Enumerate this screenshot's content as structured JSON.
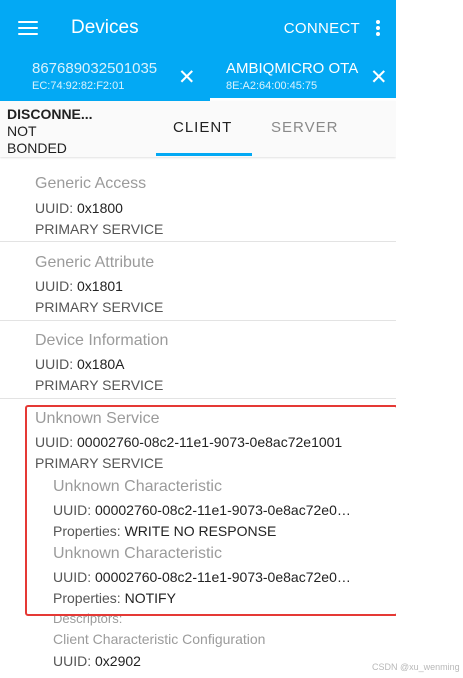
{
  "toolbar": {
    "title": "Devices",
    "connect_label": "CONNECT"
  },
  "device_tabs": [
    {
      "name": "867689032501035",
      "address": "EC:74:92:82:F2:01",
      "close": "✕"
    },
    {
      "name": "AMBIQMICRO OTA",
      "address": "8E:A2:64:00:45:75",
      "close": "✕"
    }
  ],
  "connection": {
    "state": "DISCONNE...",
    "bond_line1": "NOT",
    "bond_line2": "BONDED"
  },
  "tabs": {
    "client": "CLIENT",
    "server": "SERVER"
  },
  "services": [
    {
      "name": "Generic Access",
      "uuid_label": "UUID:",
      "uuid": "0x1800",
      "type": "PRIMARY SERVICE"
    },
    {
      "name": "Generic Attribute",
      "uuid_label": "UUID:",
      "uuid": "0x1801",
      "type": "PRIMARY SERVICE"
    },
    {
      "name": "Device Information",
      "uuid_label": "UUID:",
      "uuid": "0x180A",
      "type": "PRIMARY SERVICE"
    },
    {
      "name": "Unknown Service",
      "uuid_label": "UUID:",
      "uuid": "00002760-08c2-11e1-9073-0e8ac72e1001",
      "type": "PRIMARY SERVICE"
    }
  ],
  "characteristics": [
    {
      "name": "Unknown Characteristic",
      "uuid_label": "UUID:",
      "uuid": "00002760-08c2-11e1-9073-0e8ac72e0…",
      "prop_label": "Properties:",
      "properties": "WRITE NO RESPONSE"
    },
    {
      "name": "Unknown Characteristic",
      "uuid_label": "UUID:",
      "uuid": "00002760-08c2-11e1-9073-0e8ac72e0…",
      "prop_label": "Properties:",
      "properties": "NOTIFY"
    }
  ],
  "descriptor": {
    "label": "Descriptors:",
    "name": "Client Characteristic Configuration",
    "uuid_label": "UUID:",
    "uuid": "0x2902"
  },
  "watermark": "CSDN @xu_wenming",
  "colors": {
    "primary": "#03a9f4",
    "highlight_box": "#e53935"
  },
  "icons": {
    "menu": "hamburger-menu-icon",
    "overflow": "more-vert-icon",
    "close": "close-icon"
  }
}
